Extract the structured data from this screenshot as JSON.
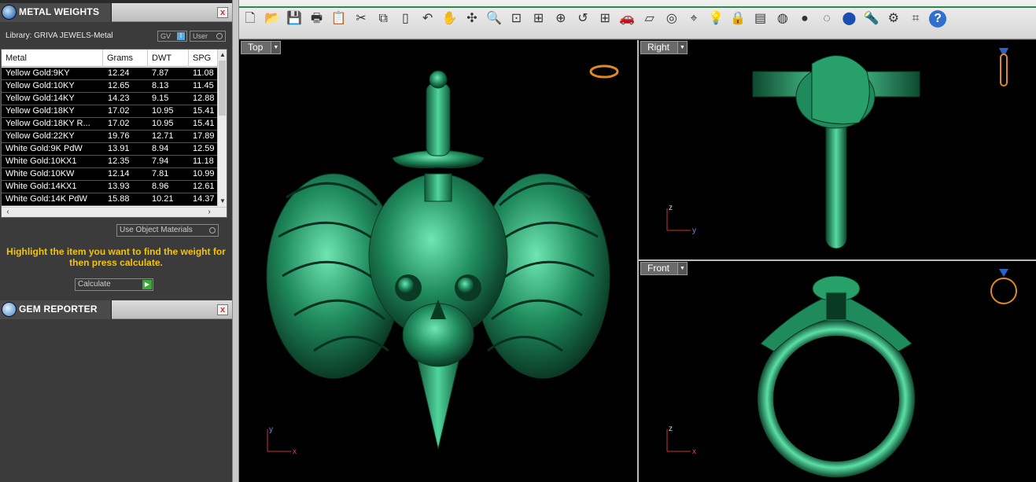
{
  "left_panel": {
    "metal_weights": {
      "title": "METAL WEIGHTS",
      "close": "x",
      "library_label": "Library: GRIVA JEWELS-Metal",
      "gv_label": "GV",
      "gv_indicator": "I",
      "user_label": "User",
      "columns": [
        "Metal",
        "Grams",
        "DWT",
        "SPG"
      ],
      "rows": [
        [
          "Yellow Gold:9KY",
          "12.24",
          "7.87",
          "11.08"
        ],
        [
          "Yellow Gold:10KY",
          "12.65",
          "8.13",
          "11.45"
        ],
        [
          "Yellow Gold:14KY",
          "14.23",
          "9.15",
          "12.88"
        ],
        [
          "Yellow Gold:18KY",
          "17.02",
          "10.95",
          "15.41"
        ],
        [
          "Yellow Gold:18KY R...",
          "17.02",
          "10.95",
          "15.41"
        ],
        [
          "Yellow Gold:22KY",
          "19.76",
          "12.71",
          "17.89"
        ],
        [
          "White Gold:9K PdW",
          "13.91",
          "8.94",
          "12.59"
        ],
        [
          "White Gold:10KX1",
          "12.35",
          "7.94",
          "11.18"
        ],
        [
          "White Gold:10KW",
          "12.14",
          "7.81",
          "10.99"
        ],
        [
          "White Gold:14KX1",
          "13.93",
          "8.96",
          "12.61"
        ],
        [
          "White Gold:14K PdW",
          "15.88",
          "10.21",
          "14.37"
        ]
      ],
      "use_object_materials": "Use Object Materials",
      "hint": "Highlight the item you want to find the weight for then press calculate.",
      "calculate": "Calculate"
    },
    "gem_reporter": {
      "title": "GEM REPORTER",
      "close": "x"
    }
  },
  "toolbar": {
    "icons": [
      "new-file-icon",
      "open-folder-icon",
      "save-icon",
      "print-icon",
      "paste-icon",
      "cut-icon",
      "copy-icon",
      "clipboard-icon",
      "undo-icon",
      "pan-hand-icon",
      "rotate-view-icon",
      "zoom-icon",
      "zoom-window-icon",
      "zoom-extents-icon",
      "zoom-selected-icon",
      "undo-view-icon",
      "four-viewports-icon",
      "car-icon",
      "construction-plane-icon",
      "osnap-icon",
      "gumball-icon",
      "light-bulb-icon",
      "lock-icon",
      "layer-icon",
      "color-wheel-icon",
      "shaded-sphere-icon",
      "wireframe-sphere-icon",
      "render-sphere-icon",
      "flashlight-icon",
      "settings-gear-icon",
      "plugin-icon",
      "help-icon"
    ]
  },
  "viewports": {
    "top": {
      "label": "Top",
      "axis_x": "x",
      "axis_y": "y"
    },
    "right": {
      "label": "Right",
      "axis_h": "y",
      "axis_v": "z"
    },
    "front": {
      "label": "Front",
      "axis_h": "x",
      "axis_v": "z"
    }
  },
  "colors": {
    "model_green": "#1f8a5c",
    "model_highlight": "#5fe0a8",
    "hint_yellow": "#f5c400",
    "viewport_bg": "#000000"
  }
}
